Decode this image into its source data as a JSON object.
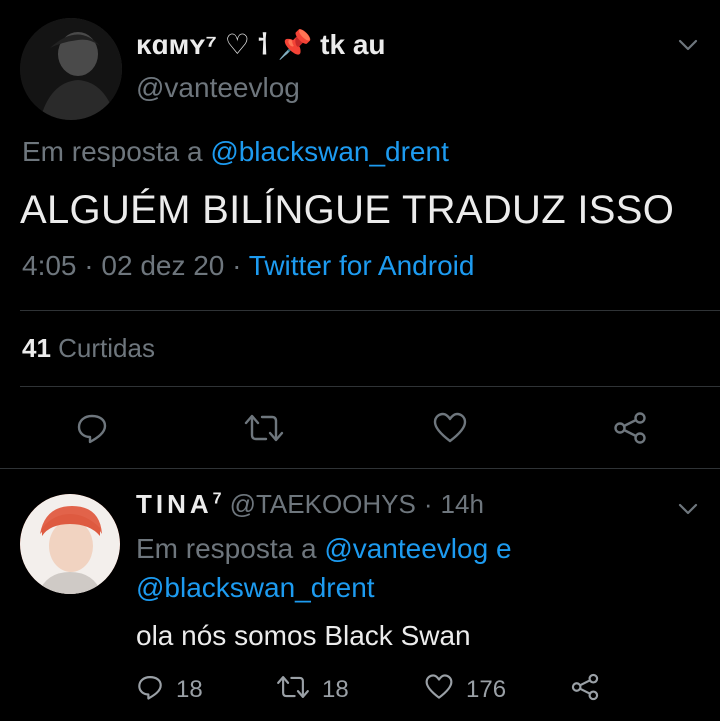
{
  "main_tweet": {
    "display_name": "ĸɑᴍʏ⁷ ♡ ⸶ 📌 tk au",
    "handle": "@vanteevlog",
    "reply_prefix": "Em resposta a",
    "reply_to": "@blackswan_drent",
    "text": "ALGUÉM BILÍNGUE TRADUZ ISSO",
    "time": "4:05",
    "date": "02 dez 20",
    "separator": "·",
    "client": "Twitter for Android",
    "likes_count": "41",
    "likes_label": "Curtidas"
  },
  "reply_tweet": {
    "display_name": "TINA",
    "name_sup": "7",
    "handle": "@TAEKOOHYS",
    "separator": "·",
    "age": "14h",
    "reply_prefix": "Em resposta a",
    "reply_to_1": "@vanteevlog",
    "conj": "e",
    "reply_to_2": "@blackswan_drent",
    "text": "ola nós somos Black Swan",
    "reply_count": "18",
    "retweet_count": "18",
    "like_count": "176"
  },
  "colors": {
    "background": "#000000",
    "link": "#1d9bf0",
    "muted": "#6e767d",
    "text": "#ececec",
    "divider": "#2f3336"
  },
  "icons": [
    "reply-icon",
    "retweet-icon",
    "like-icon",
    "share-icon",
    "chevron-down-icon"
  ]
}
